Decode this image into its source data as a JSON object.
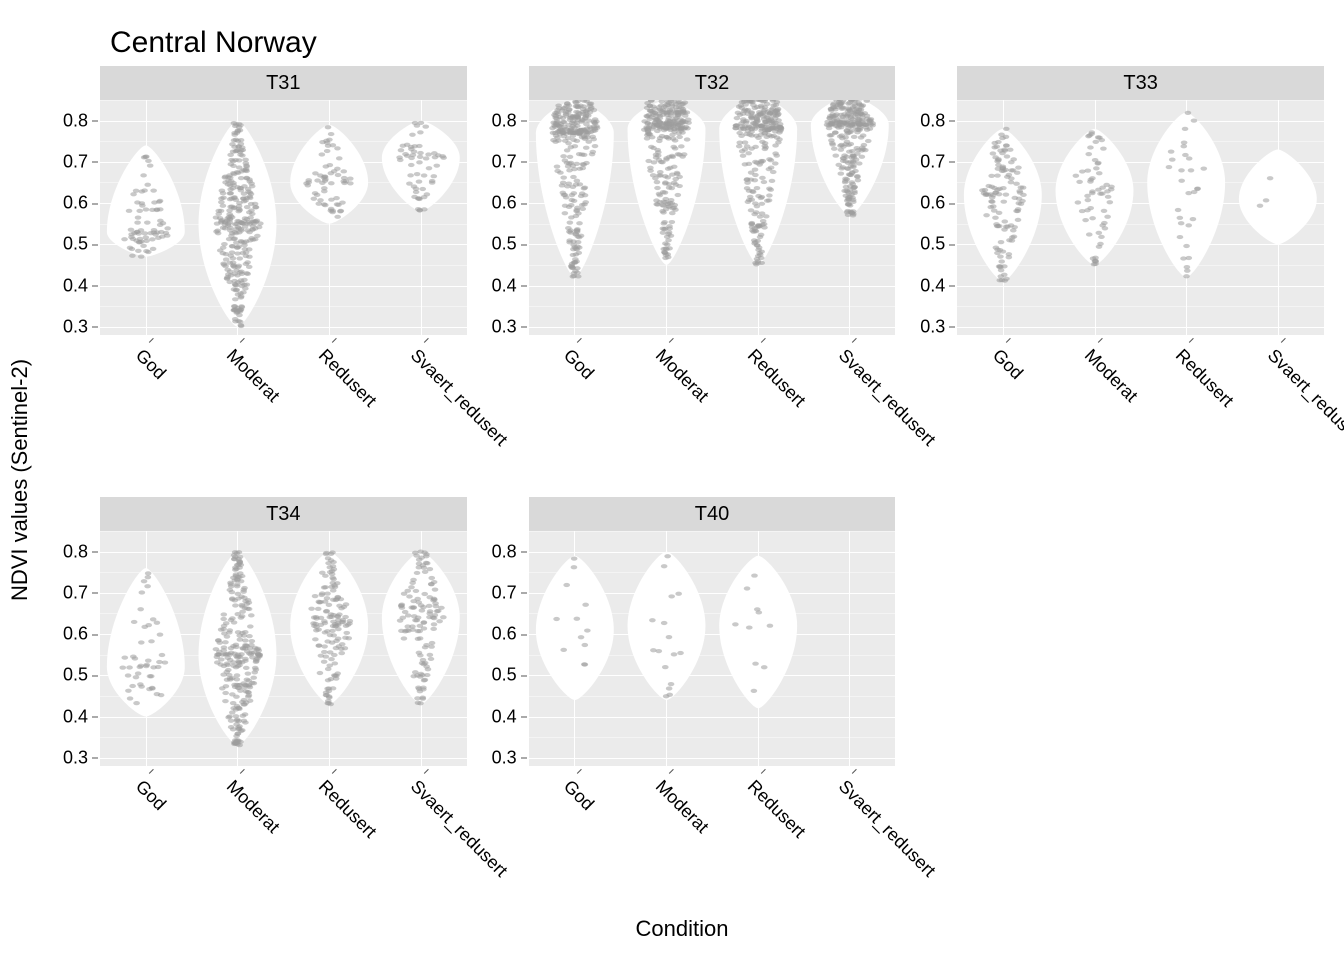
{
  "chart_data": {
    "type": "violin_with_jitter",
    "title": "Central Norway",
    "xlabel": "Condition",
    "ylabel": "NDVI values (Sentinel-2)",
    "categories": [
      "God",
      "Moderat",
      "Redusert",
      "Svaert_redusert"
    ],
    "ylim": [
      0.28,
      0.85
    ],
    "yticks": [
      0.3,
      0.4,
      0.5,
      0.6,
      0.7,
      0.8
    ],
    "facets": [
      {
        "name": "T31",
        "series": {
          "God": {
            "min": 0.47,
            "max": 0.74,
            "peak": 0.53,
            "n": 70
          },
          "Moderat": {
            "min": 0.3,
            "max": 0.8,
            "peak": 0.55,
            "n": 400
          },
          "Redusert": {
            "min": 0.55,
            "max": 0.79,
            "peak": 0.65,
            "n": 60
          },
          "Svaert_redusert": {
            "min": 0.58,
            "max": 0.8,
            "peak": 0.71,
            "n": 55
          }
        }
      },
      {
        "name": "T32",
        "series": {
          "God": {
            "min": 0.42,
            "max": 0.85,
            "peak": 0.77,
            "n": 450
          },
          "Moderat": {
            "min": 0.45,
            "max": 0.85,
            "peak": 0.78,
            "n": 450
          },
          "Redusert": {
            "min": 0.45,
            "max": 0.86,
            "peak": 0.78,
            "n": 350
          },
          "Svaert_redusert": {
            "min": 0.57,
            "max": 0.86,
            "peak": 0.79,
            "n": 350
          }
        }
      },
      {
        "name": "T33",
        "series": {
          "God": {
            "min": 0.41,
            "max": 0.78,
            "peak": 0.62,
            "n": 120
          },
          "Moderat": {
            "min": 0.45,
            "max": 0.78,
            "peak": 0.63,
            "n": 60
          },
          "Redusert": {
            "min": 0.42,
            "max": 0.82,
            "peak": 0.65,
            "n": 30
          },
          "Svaert_redusert": {
            "min": 0.5,
            "max": 0.73,
            "peak": 0.61,
            "n": 3
          }
        }
      },
      {
        "name": "T34",
        "series": {
          "God": {
            "min": 0.4,
            "max": 0.76,
            "peak": 0.52,
            "n": 45
          },
          "Moderat": {
            "min": 0.33,
            "max": 0.8,
            "peak": 0.55,
            "n": 260
          },
          "Redusert": {
            "min": 0.43,
            "max": 0.8,
            "peak": 0.62,
            "n": 140
          },
          "Svaert_redusert": {
            "min": 0.43,
            "max": 0.8,
            "peak": 0.64,
            "n": 120
          }
        }
      },
      {
        "name": "T40",
        "series": {
          "God": {
            "min": 0.44,
            "max": 0.79,
            "peak": 0.61,
            "n": 12
          },
          "Moderat": {
            "min": 0.44,
            "max": 0.8,
            "peak": 0.62,
            "n": 16
          },
          "Redusert": {
            "min": 0.42,
            "max": 0.79,
            "peak": 0.62,
            "n": 10
          }
        }
      }
    ]
  }
}
